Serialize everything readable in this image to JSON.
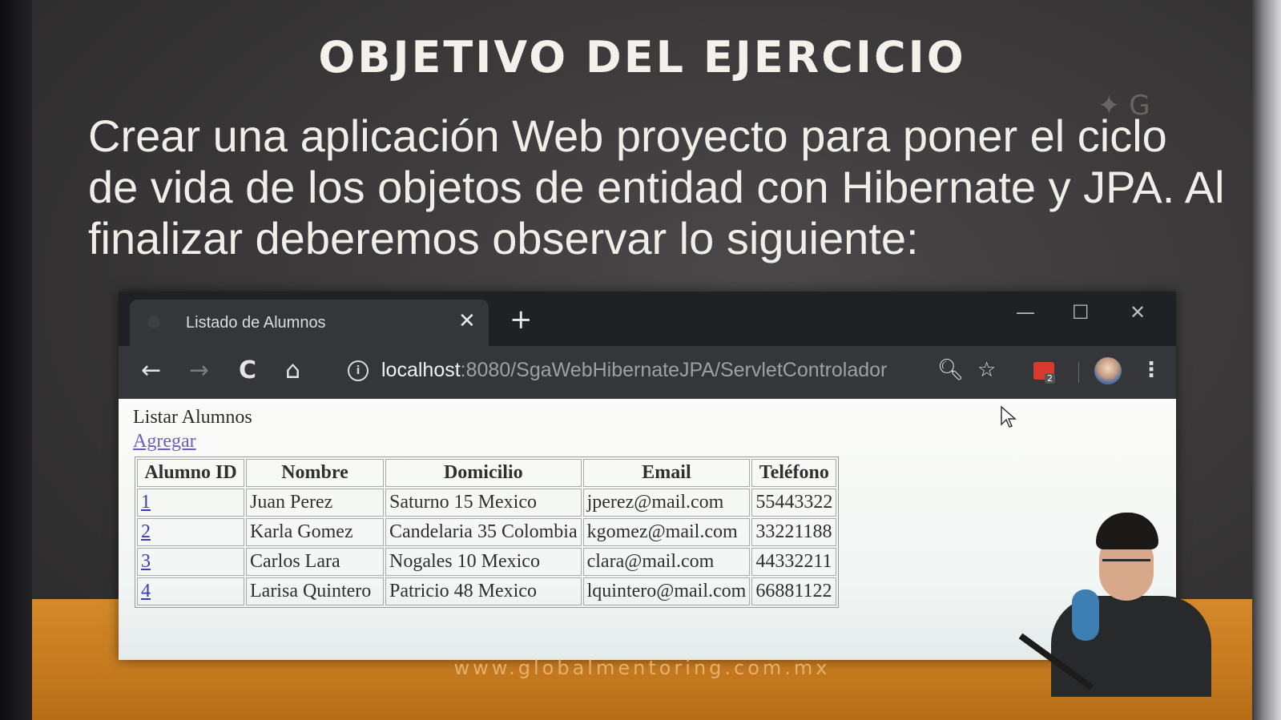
{
  "slide": {
    "title": "OBJETIVO DEL EJERCICIO",
    "text": "Crear una aplicación Web proyecto para poner el ciclo de vida de los objetos de entidad con Hibernate y JPA. Al finalizar deberemos observar lo siguiente:",
    "footer_url": "www.globalmentoring.com.mx"
  },
  "browser": {
    "tab_title": "Listado de Alumnos",
    "tab_close": "✕",
    "new_tab": "+",
    "window_controls": {
      "minimize": "—",
      "maximize": "☐",
      "close": "✕"
    },
    "nav": {
      "back": "←",
      "forward": "→",
      "reload": "C",
      "home": "⌂"
    },
    "url_host": "localhost",
    "url_rest": ":8080/SgaWebHibernateJPA/ServletControlador",
    "icons": {
      "zoom": "zoom-icon",
      "star": "star-icon",
      "extension": "extension-icon",
      "menu": "kebab-menu-icon"
    },
    "ext_badge": "2",
    "menu_glyph": "⋮",
    "zoom_glyph": "🔍︎",
    "star_glyph": "☆"
  },
  "page": {
    "heading": "Listar Alumnos",
    "add_link": "Agregar",
    "columns": [
      "Alumno ID",
      "Nombre",
      "Domicilio",
      "Email",
      "Teléfono"
    ],
    "rows": [
      {
        "id": "1",
        "nombre": "Juan Perez",
        "domicilio": "Saturno 15 Mexico",
        "email": "jperez@mail.com",
        "telefono": "55443322"
      },
      {
        "id": "2",
        "nombre": "Karla Gomez",
        "domicilio": "Candelaria 35 Colombia",
        "email": "kgomez@mail.com",
        "telefono": "33221188"
      },
      {
        "id": "3",
        "nombre": "Carlos Lara",
        "domicilio": "Nogales 10 Mexico",
        "email": "clara@mail.com",
        "telefono": "44332211"
      },
      {
        "id": "4",
        "nombre": "Larisa Quintero",
        "domicilio": "Patricio 48 Mexico",
        "email": "lquintero@mail.com",
        "telefono": "66881122"
      }
    ]
  }
}
